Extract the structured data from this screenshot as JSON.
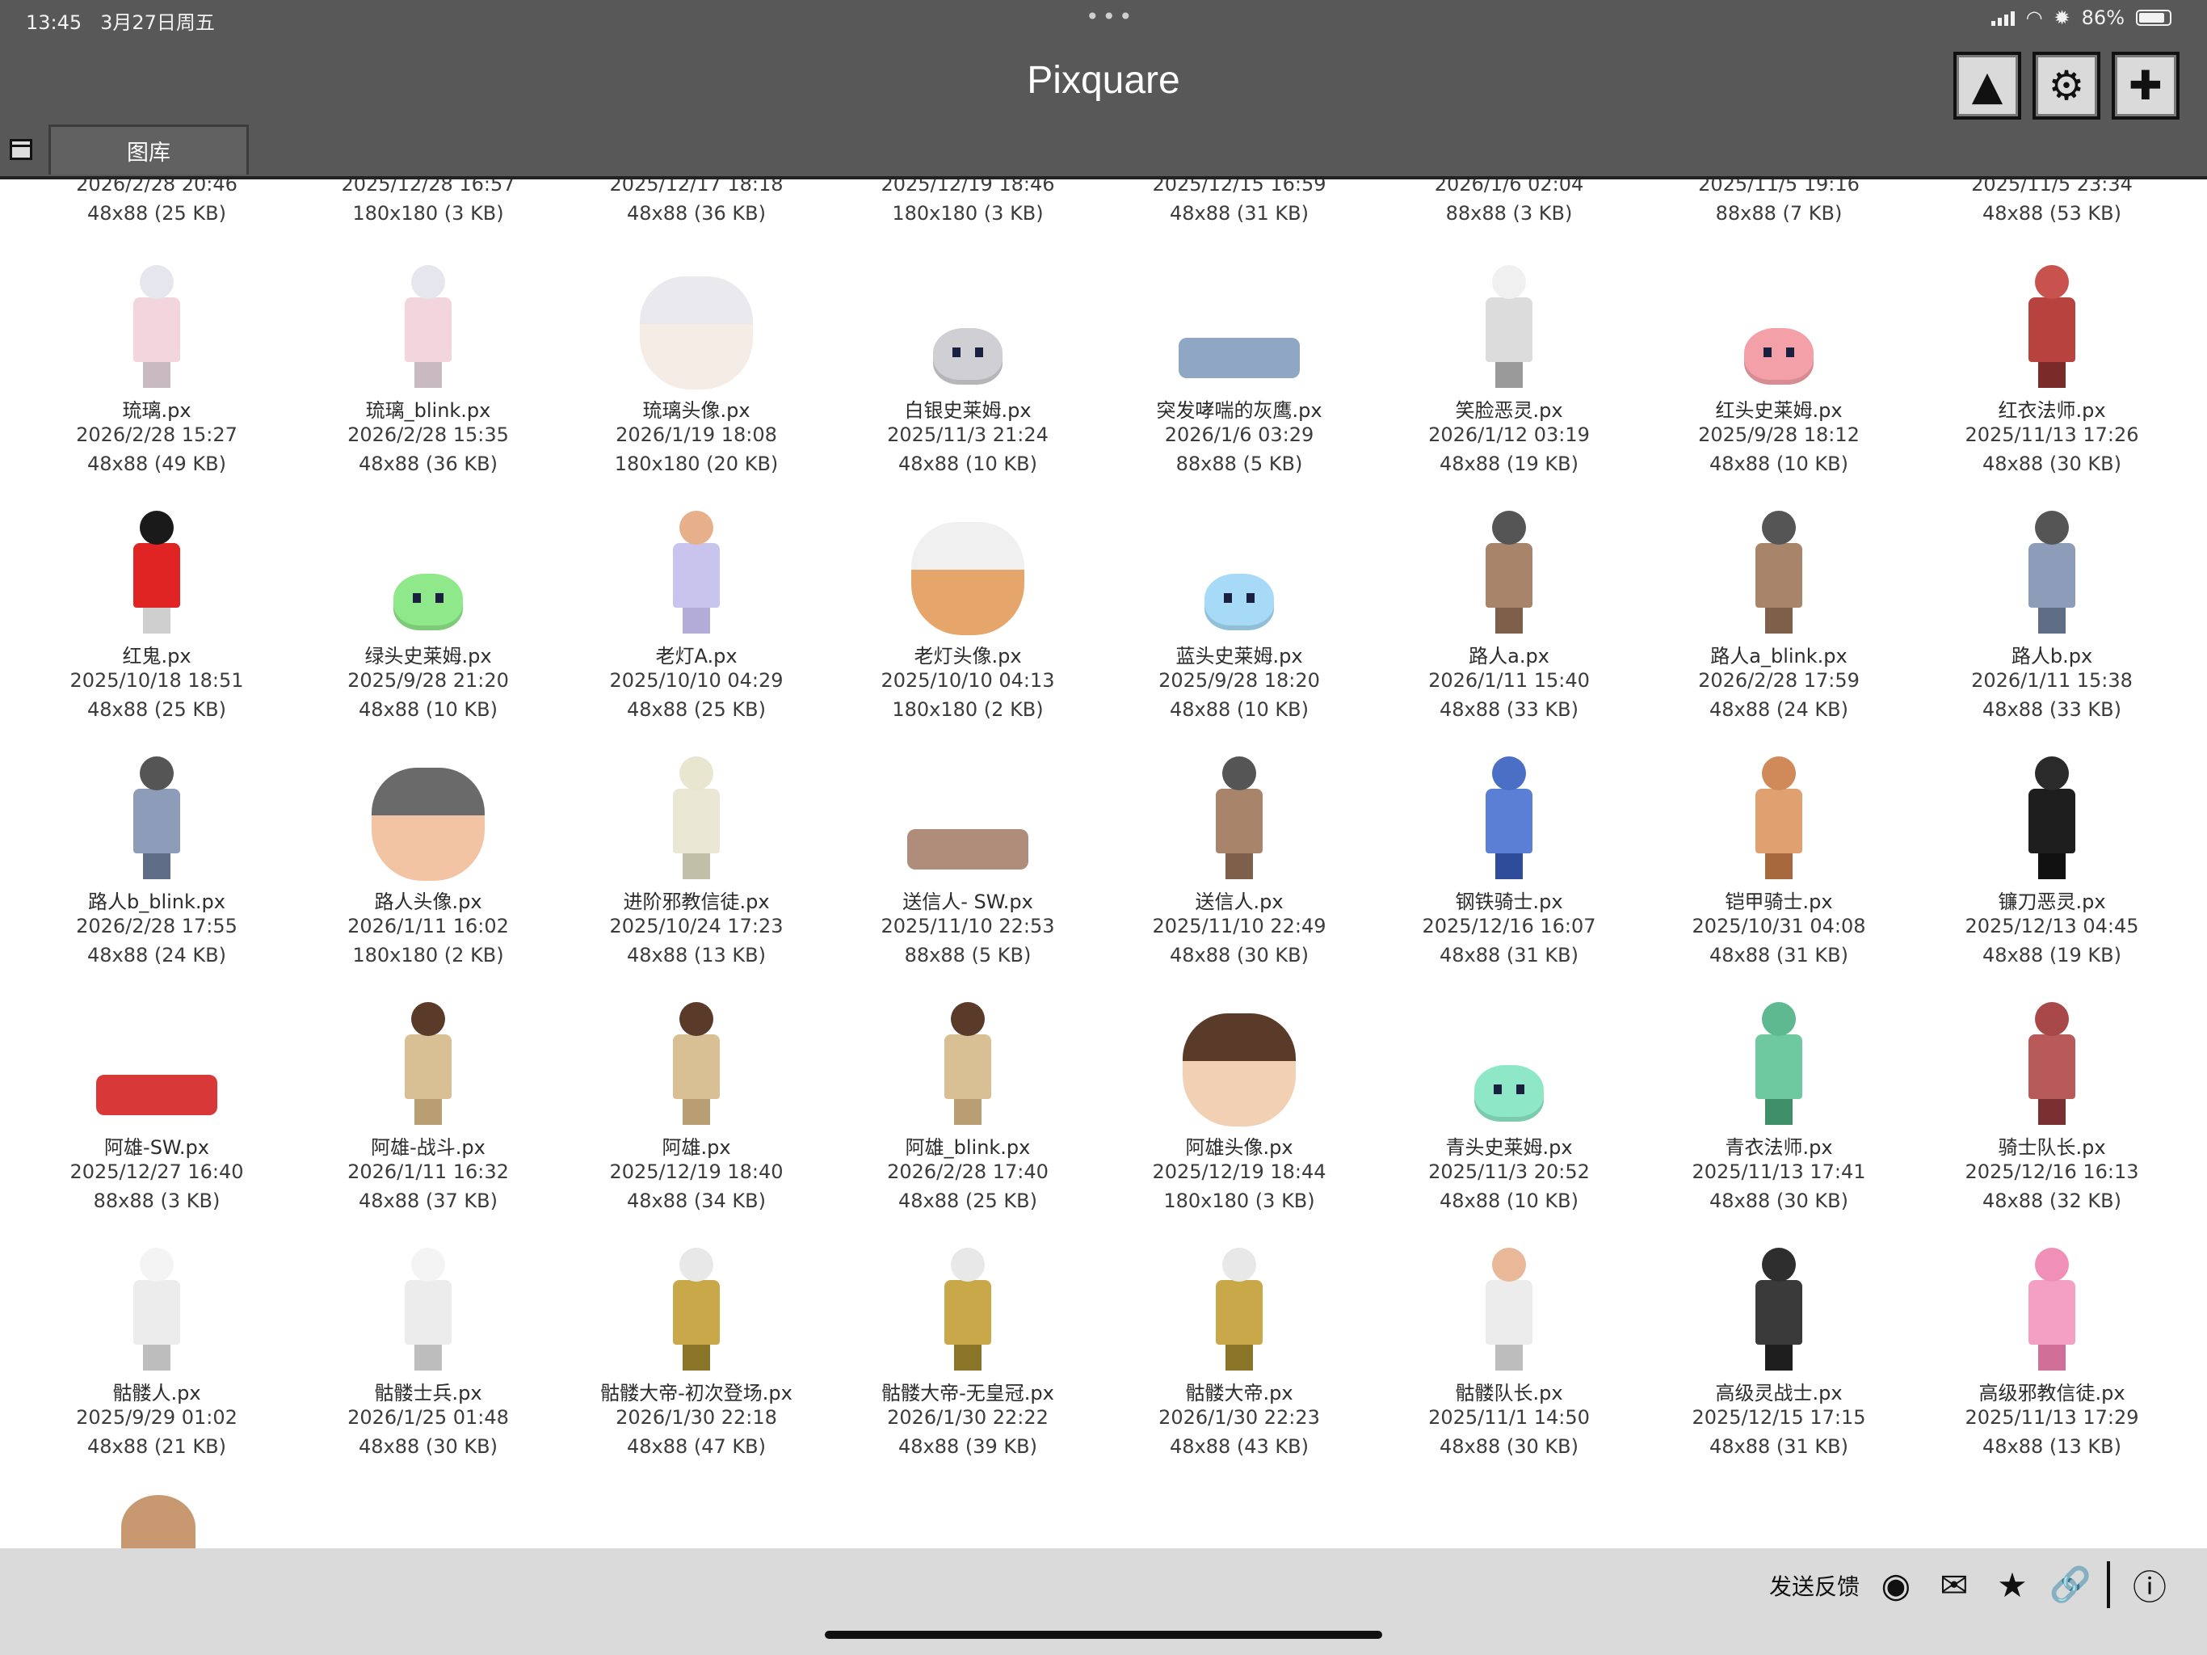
{
  "status_bar": {
    "time": "13:45",
    "date": "3月27日周五",
    "battery": "86%"
  },
  "app": {
    "title": "Pixquare"
  },
  "toolbar": {
    "buttons": [
      {
        "name": "ghost-button",
        "icon": "ghost-icon",
        "glyph": "▲"
      },
      {
        "name": "settings-button",
        "icon": "gear-icon",
        "glyph": "⚙"
      },
      {
        "name": "add-button",
        "icon": "plus-icon",
        "glyph": "✚"
      }
    ]
  },
  "tabs": [
    {
      "label": "图库"
    }
  ],
  "gallery": {
    "top_row": [
      {
        "date": "2026/2/28 20:46",
        "size": "48x88 (25 KB)"
      },
      {
        "date": "2025/12/28 16:57",
        "size": "180x180 (3 KB)"
      },
      {
        "date": "2025/12/17 18:18",
        "size": "48x88 (36 KB)"
      },
      {
        "date": "2025/12/19 18:46",
        "size": "180x180 (3 KB)"
      },
      {
        "date": "2025/12/15 16:59",
        "size": "48x88 (31 KB)"
      },
      {
        "date": "2026/1/6 02:04",
        "size": "88x88 (3 KB)"
      },
      {
        "date": "2025/11/5 19:16",
        "size": "88x88 (7 KB)"
      },
      {
        "date": "2025/11/5 23:34",
        "size": "48x88 (53 KB)"
      }
    ],
    "rows": [
      [
        {
          "name": "琉璃.px",
          "date": "2026/2/28 15:27",
          "size": "48x88 (49 KB)",
          "kind": "figure",
          "c1": "#e6e6ee",
          "c2": "#f3d6dd",
          "c3": "#c9b9c1"
        },
        {
          "name": "琉璃_blink.px",
          "date": "2026/2/28 15:35",
          "size": "48x88 (36 KB)",
          "kind": "figure",
          "c1": "#e6e6ee",
          "c2": "#f3d6dd",
          "c3": "#c9b9c1"
        },
        {
          "name": "琉璃头像.px",
          "date": "2026/1/19 18:08",
          "size": "180x180 (20 KB)",
          "kind": "head",
          "c1": "#e9e9ee",
          "c2": "#f6ece6"
        },
        {
          "name": "白银史莱姆.px",
          "date": "2025/11/3 21:24",
          "size": "48x88 (10 KB)",
          "kind": "slime",
          "c1": "#cfcfd4"
        },
        {
          "name": "突发哮喘的灰鹰.px",
          "date": "2026/1/6 03:29",
          "size": "88x88 (5 KB)",
          "kind": "lying",
          "c1": "#8fa6c4"
        },
        {
          "name": "笑脸恶灵.px",
          "date": "2026/1/12 03:19",
          "size": "48x88 (19 KB)",
          "kind": "figure",
          "c1": "#f0f0f0",
          "c2": "#dcdcdc",
          "c3": "#9a9a9a"
        },
        {
          "name": "红头史莱姆.px",
          "date": "2025/9/28 18:12",
          "size": "48x88 (10 KB)",
          "kind": "slime",
          "c1": "#f4a0a8"
        },
        {
          "name": "红衣法师.px",
          "date": "2025/11/13 17:26",
          "size": "48x88 (30 KB)",
          "kind": "figure",
          "c1": "#c8524e",
          "c2": "#b8423e",
          "c3": "#7a2a28"
        }
      ],
      [
        {
          "name": "红鬼.px",
          "date": "2025/10/18 18:51",
          "size": "48x88 (25 KB)",
          "kind": "figure",
          "c1": "#1a1a1a",
          "c2": "#e02424",
          "c3": "#cfcfcf"
        },
        {
          "name": "绿头史莱姆.px",
          "date": "2025/9/28 21:20",
          "size": "48x88 (10 KB)",
          "kind": "slime",
          "c1": "#8fe88a"
        },
        {
          "name": "老灯A.px",
          "date": "2025/10/10 04:29",
          "size": "48x88 (25 KB)",
          "kind": "figure",
          "c1": "#e8b08a",
          "c2": "#c9c4ee",
          "c3": "#b3acd8"
        },
        {
          "name": "老灯头像.px",
          "date": "2025/10/10 04:13",
          "size": "180x180 (2 KB)",
          "kind": "head",
          "c1": "#f0f0f0",
          "c2": "#e6a56a"
        },
        {
          "name": "蓝头史莱姆.px",
          "date": "2025/9/28 18:20",
          "size": "48x88 (10 KB)",
          "kind": "slime",
          "c1": "#a6daf6"
        },
        {
          "name": "路人a.px",
          "date": "2026/1/11 15:40",
          "size": "48x88 (33 KB)",
          "kind": "figure",
          "c1": "#555555",
          "c2": "#a8846a",
          "c3": "#7d5f4a"
        },
        {
          "name": "路人a_blink.px",
          "date": "2026/2/28 17:59",
          "size": "48x88 (24 KB)",
          "kind": "figure",
          "c1": "#555555",
          "c2": "#a8846a",
          "c3": "#7d5f4a"
        },
        {
          "name": "路人b.px",
          "date": "2026/1/11 15:38",
          "size": "48x88 (33 KB)",
          "kind": "figure",
          "c1": "#555555",
          "c2": "#8d9cb8",
          "c3": "#5f6d86"
        }
      ],
      [
        {
          "name": "路人b_blink.px",
          "date": "2026/2/28 17:55",
          "size": "48x88 (24 KB)",
          "kind": "figure",
          "c1": "#555555",
          "c2": "#8d9cb8",
          "c3": "#5f6d86"
        },
        {
          "name": "路人头像.px",
          "date": "2026/1/11 16:02",
          "size": "180x180 (2 KB)",
          "kind": "head",
          "c1": "#6a6a6a",
          "c2": "#f2c4a4"
        },
        {
          "name": "进阶邪教信徒.px",
          "date": "2025/10/24 17:23",
          "size": "48x88 (13 KB)",
          "kind": "figure",
          "c1": "#e8e6cf",
          "c2": "#eae8d4",
          "c3": "#c2bfa8"
        },
        {
          "name": "送信人- SW.px",
          "date": "2025/11/10 22:53",
          "size": "88x88 (5 KB)",
          "kind": "lying",
          "c1": "#b08c7a"
        },
        {
          "name": "送信人.px",
          "date": "2025/11/10 22:49",
          "size": "48x88 (30 KB)",
          "kind": "figure",
          "c1": "#555555",
          "c2": "#a8846a",
          "c3": "#7d5f4a"
        },
        {
          "name": "钢铁骑士.px",
          "date": "2025/12/16 16:07",
          "size": "48x88 (31 KB)",
          "kind": "figure",
          "c1": "#4a6fc4",
          "c2": "#5a7fd4",
          "c3": "#2e4c9a"
        },
        {
          "name": "铠甲骑士.px",
          "date": "2025/10/31 04:08",
          "size": "48x88 (31 KB)",
          "kind": "figure",
          "c1": "#d08a5a",
          "c2": "#e0a070",
          "c3": "#a8683e"
        },
        {
          "name": "镰刀恶灵.px",
          "date": "2025/12/13 04:45",
          "size": "48x88 (19 KB)",
          "kind": "figure",
          "c1": "#2a2a2a",
          "c2": "#1e1e1e",
          "c3": "#111111"
        }
      ],
      [
        {
          "name": "阿雄-SW.px",
          "date": "2025/12/27 16:40",
          "size": "88x88 (3 KB)",
          "kind": "lying",
          "c1": "#d83838"
        },
        {
          "name": "阿雄-战斗.px",
          "date": "2026/1/11 16:32",
          "size": "48x88 (37 KB)",
          "kind": "figure",
          "c1": "#5a3a28",
          "c2": "#d8c094",
          "c3": "#b89e72"
        },
        {
          "name": "阿雄.px",
          "date": "2025/12/19 18:40",
          "size": "48x88 (34 KB)",
          "kind": "figure",
          "c1": "#5a3a28",
          "c2": "#d8c094",
          "c3": "#b89e72"
        },
        {
          "name": "阿雄_blink.px",
          "date": "2026/2/28 17:40",
          "size": "48x88 (25 KB)",
          "kind": "figure",
          "c1": "#5a3a28",
          "c2": "#d8c094",
          "c3": "#b89e72"
        },
        {
          "name": "阿雄头像.px",
          "date": "2025/12/19 18:44",
          "size": "180x180 (3 KB)",
          "kind": "head",
          "c1": "#5a3a28",
          "c2": "#f2d0b4"
        },
        {
          "name": "青头史莱姆.px",
          "date": "2025/11/3 20:52",
          "size": "48x88 (10 KB)",
          "kind": "slime",
          "c1": "#8ee8c8"
        },
        {
          "name": "青衣法师.px",
          "date": "2025/11/13 17:41",
          "size": "48x88 (30 KB)",
          "kind": "figure",
          "c1": "#5eb890",
          "c2": "#6ec8a0",
          "c3": "#3e8e6a"
        },
        {
          "name": "骑士队长.px",
          "date": "2025/12/16 16:13",
          "size": "48x88 (32 KB)",
          "kind": "figure",
          "c1": "#a84848",
          "c2": "#b85a5a",
          "c3": "#7a3030"
        }
      ],
      [
        {
          "name": "骷髅人.px",
          "date": "2025/9/29 01:02",
          "size": "48x88 (21 KB)",
          "kind": "figure",
          "c1": "#f4f4f4",
          "c2": "#ececec",
          "c3": "#bdbdbd"
        },
        {
          "name": "骷髅士兵.px",
          "date": "2026/1/25 01:48",
          "size": "48x88 (30 KB)",
          "kind": "figure",
          "c1": "#f4f4f4",
          "c2": "#ececec",
          "c3": "#bdbdbd"
        },
        {
          "name": "骷髅大帝-初次登场.px",
          "date": "2026/1/30 22:18",
          "size": "48x88 (47 KB)",
          "kind": "figure",
          "c1": "#e8e8e8",
          "c2": "#c8a848",
          "c3": "#8a7428"
        },
        {
          "name": "骷髅大帝-无皇冠.px",
          "date": "2026/1/30 22:22",
          "size": "48x88 (39 KB)",
          "kind": "figure",
          "c1": "#e8e8e8",
          "c2": "#c8a848",
          "c3": "#8a7428"
        },
        {
          "name": "骷髅大帝.px",
          "date": "2026/1/30 22:23",
          "size": "48x88 (43 KB)",
          "kind": "figure",
          "c1": "#e8e8e8",
          "c2": "#c8a848",
          "c3": "#8a7428"
        },
        {
          "name": "骷髅队长.px",
          "date": "2025/11/1 14:50",
          "size": "48x88 (30 KB)",
          "kind": "figure",
          "c1": "#e8b898",
          "c2": "#ececec",
          "c3": "#bdbdbd"
        },
        {
          "name": "高级灵战士.px",
          "date": "2025/12/15 17:15",
          "size": "48x88 (31 KB)",
          "kind": "figure",
          "c1": "#2e2e2e",
          "c2": "#3a3a3a",
          "c3": "#1e1e1e"
        },
        {
          "name": "高级邪教信徒.px",
          "date": "2025/11/13 17:29",
          "size": "48x88 (13 KB)",
          "kind": "figure",
          "c1": "#f090b8",
          "c2": "#f4a0c4",
          "c3": "#d07098"
        }
      ]
    ]
  },
  "footer": {
    "feedback_label": "发送反馈",
    "icons": [
      {
        "name": "discord-icon",
        "glyph": "◉"
      },
      {
        "name": "mail-icon",
        "glyph": "✉"
      },
      {
        "name": "star-icon",
        "glyph": "★"
      },
      {
        "name": "link-icon",
        "glyph": "🔗"
      },
      {
        "name": "info-icon",
        "glyph": "ⓘ"
      }
    ]
  }
}
